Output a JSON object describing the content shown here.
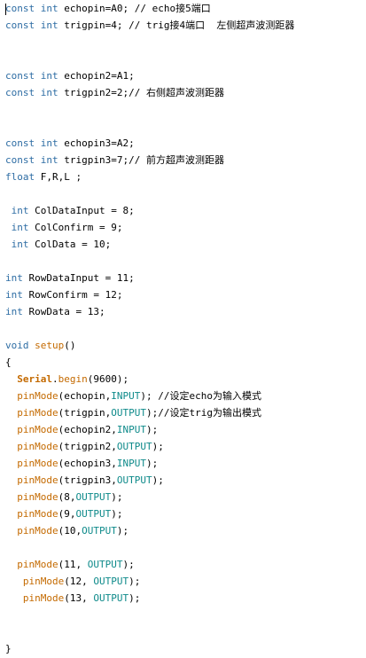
{
  "editor": {
    "lines": [
      {
        "i": 1,
        "text": "const int echopin=A0; // echo接5端口"
      },
      {
        "i": 2,
        "text": "const int trigpin=4; // trig接4端口  左侧超声波测距器"
      },
      {
        "i": 5,
        "text": "const int echopin2=A1;"
      },
      {
        "i": 6,
        "text": "const int trigpin2=2;// 右侧超声波测距器"
      },
      {
        "i": 9,
        "text": "const int echopin3=A2;"
      },
      {
        "i": 10,
        "text": "const int trigpin3=7;// 前方超声波测距器"
      },
      {
        "i": 11,
        "text": "float F,R,L ;"
      },
      {
        "i": 13,
        "text": " int ColDataInput = 8;"
      },
      {
        "i": 14,
        "text": " int ColConfirm = 9;"
      },
      {
        "i": 15,
        "text": " int ColData = 10;"
      },
      {
        "i": 17,
        "text": "int RowDataInput = 11;"
      },
      {
        "i": 18,
        "text": "int RowConfirm = 12;"
      },
      {
        "i": 19,
        "text": "int RowData = 13;"
      },
      {
        "i": 21,
        "text": "void setup()"
      },
      {
        "i": 22,
        "text": "{"
      },
      {
        "i": 23,
        "text": "  Serial.begin(9600);"
      },
      {
        "i": 24,
        "text": "  pinMode(echopin,INPUT); //设定echo为输入模式"
      },
      {
        "i": 25,
        "text": "  pinMode(trigpin,OUTPUT);//设定trig为输出模式"
      },
      {
        "i": 26,
        "text": "  pinMode(echopin2,INPUT);"
      },
      {
        "i": 27,
        "text": "  pinMode(trigpin2,OUTPUT);"
      },
      {
        "i": 28,
        "text": "  pinMode(echopin3,INPUT);"
      },
      {
        "i": 29,
        "text": "  pinMode(trigpin3,OUTPUT);"
      },
      {
        "i": 30,
        "text": "  pinMode(8,OUTPUT);"
      },
      {
        "i": 31,
        "text": "  pinMode(9,OUTPUT);"
      },
      {
        "i": 32,
        "text": "  pinMode(10,OUTPUT);"
      },
      {
        "i": 34,
        "text": "  pinMode(11, OUTPUT);"
      },
      {
        "i": 35,
        "text": "   pinMode(12, OUTPUT);"
      },
      {
        "i": 36,
        "text": "   pinMode(13, OUTPUT);"
      },
      {
        "i": 39,
        "text": "}"
      }
    ]
  }
}
